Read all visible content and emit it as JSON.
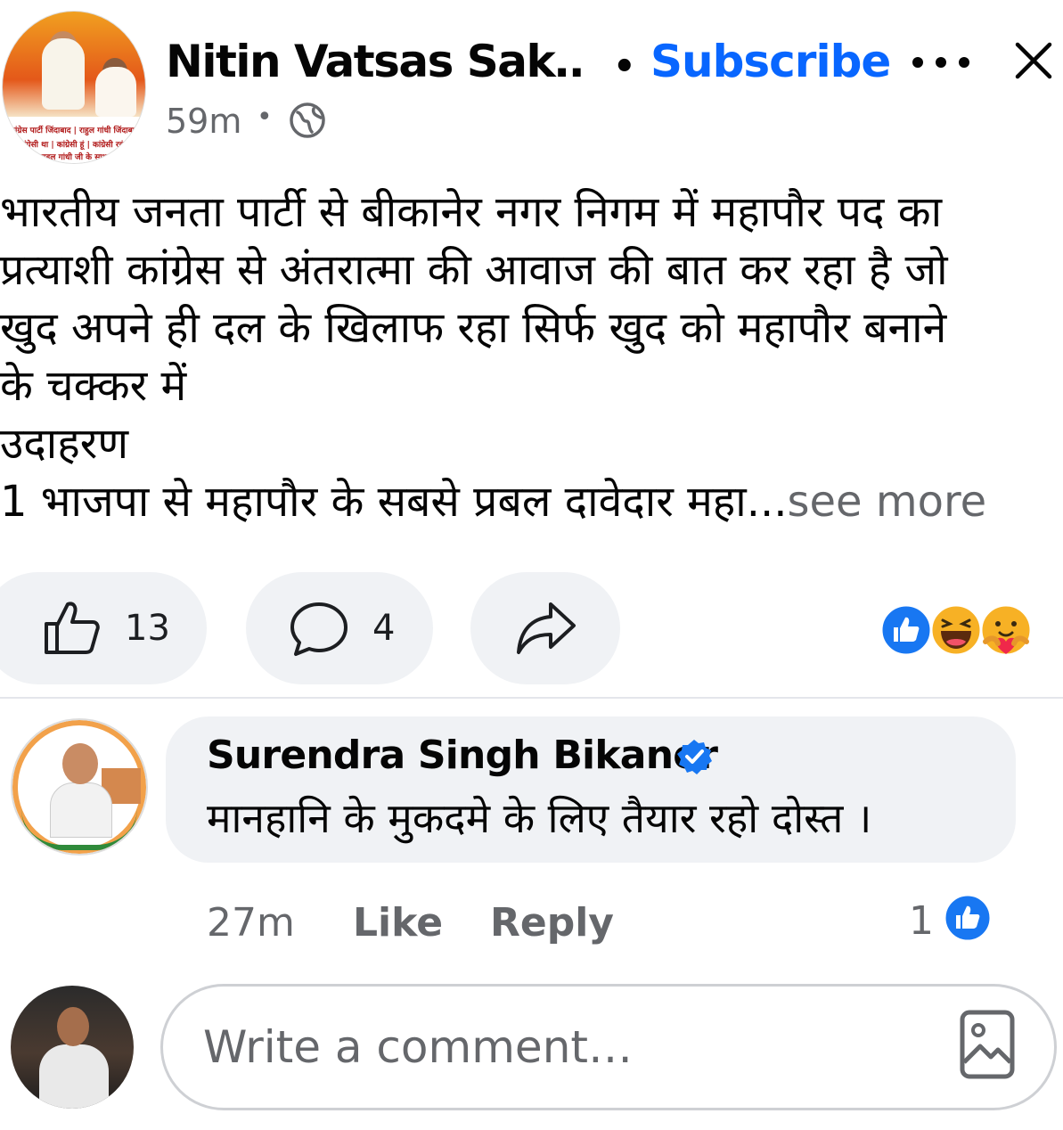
{
  "header": {
    "page_name": "Nitin Vatsas Sak…",
    "separator": "•",
    "subscribe_label": "Subscribe",
    "time": "59m",
    "time_separator": "•",
    "avatar_banner_lines": [
      "कांग्रेस पार्टी जिंदाबाद | राहुल गांधी जिंदाबाद",
      "कांग्रेसी था | कांग्रेसी हूं | कांग्रेसी रहूंगा",
      "राहुल गांधी जी के साथ"
    ],
    "icons": {
      "more": "more-dots-icon",
      "close": "close-icon",
      "privacy": "globe-icon"
    }
  },
  "post": {
    "text": "भारतीय जनता पार्टी से बीकानेर नगर निगम में महापौर पद का\nप्रत्याशी कांग्रेस से अंतरात्मा की आवाज की बात कर रहा है जो\nखुद अपने ही दल के खिलाफ रहा सिर्फ खुद को महापौर बनाने\nके चक्कर में\nउदाहरण\n1 भाजपा से महापौर के सबसे प्रबल दावेदार महा...",
    "see_more": "see more"
  },
  "actions": {
    "like_count": "13",
    "comment_count": "4",
    "reactions": [
      "like",
      "laugh",
      "care"
    ]
  },
  "comment": {
    "author": "Surendra Singh Bikaner",
    "verified": true,
    "text": "मानहानि के मुकदमे के लिए तैयार रहो दोस्त ।",
    "time": "27m",
    "like_label": "Like",
    "reply_label": "Reply",
    "like_count": "1"
  },
  "composer": {
    "placeholder": "Write a comment…"
  },
  "colors": {
    "accent": "#0866ff",
    "secondary_text": "#65676b",
    "pill_bg": "#f0f2f5",
    "divider": "#e4e6eb"
  }
}
